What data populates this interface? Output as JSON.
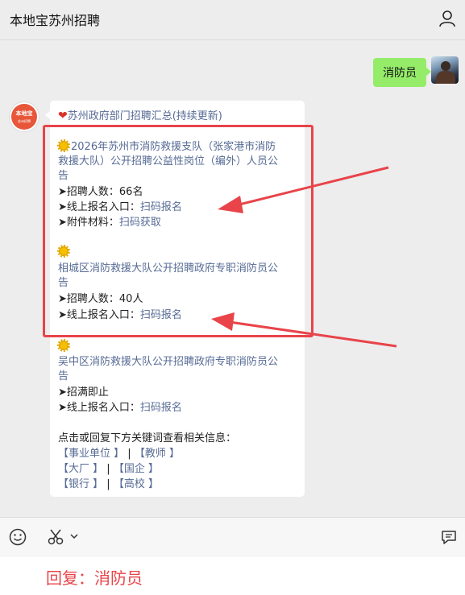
{
  "header": {
    "title": "本地宝苏州招聘"
  },
  "chat": {
    "outgoing_message": "消防员",
    "bot_avatar_text": "本地宝",
    "bot_avatar_sub": "苏州招聘"
  },
  "article": {
    "header_link": "苏州政府部门招聘汇总(持续更新)",
    "sections": [
      {
        "title_lines": [
          "2026年苏州市消防救援支队（张家港市消防",
          "救援大队）公开招聘公益性岗位（编外）人员公",
          "告"
        ],
        "items": [
          {
            "label": "➤招聘人数：",
            "value": "66名",
            "link": false
          },
          {
            "label": "➤线上报名入口：",
            "value": "扫码报名",
            "link": true
          },
          {
            "label": "➤附件材料：",
            "value": "扫码获取",
            "link": true
          }
        ]
      },
      {
        "title_lines": [
          "相城区消防救援大队公开招聘政府专职消防员公",
          "告"
        ],
        "items": [
          {
            "label": "➤招聘人数：",
            "value": "40人",
            "link": false
          },
          {
            "label": "➤线上报名入口：",
            "value": "扫码报名",
            "link": true
          }
        ]
      },
      {
        "title_lines": [
          "吴中区消防救援大队公开招聘政府专职消防员公",
          "告"
        ],
        "items": [
          {
            "label": "➤招满即止",
            "value": "",
            "link": false
          },
          {
            "label": "➤线上报名入口：",
            "value": "扫码报名",
            "link": true
          }
        ]
      }
    ],
    "keywords_intro": "点击或回复下方关键词查看相关信息：",
    "keyword_rows": [
      [
        "【事业单位 】",
        "|",
        "【教师 】"
      ],
      [
        "【大厂 】",
        "|",
        "【国企 】"
      ],
      [
        "【银行 】",
        "|",
        "【高校 】"
      ]
    ]
  },
  "caption": "回复：消防员",
  "colors": {
    "highlight": "#e8444a",
    "link": "#576b95",
    "bubble_out": "#95ec69"
  }
}
